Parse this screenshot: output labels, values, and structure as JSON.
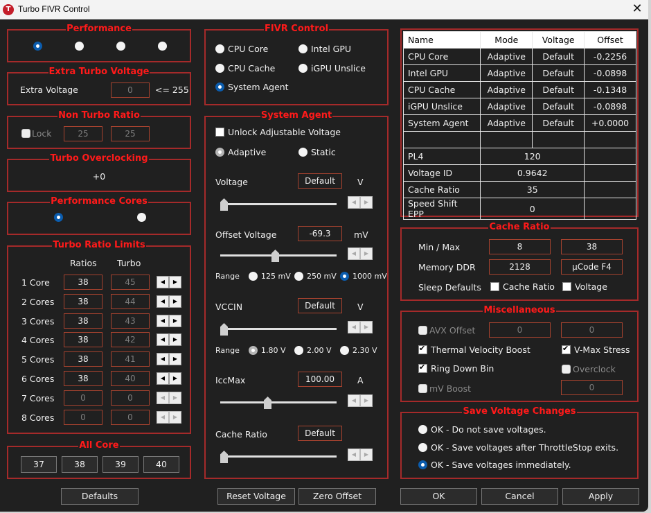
{
  "window": {
    "title": "Turbo FIVR Control",
    "icon": "throttlestop-icon",
    "close_glyph": "✕"
  },
  "performance": {
    "legend": "Performance",
    "options": [
      {
        "selected": true
      },
      {
        "selected": false
      },
      {
        "selected": false
      },
      {
        "selected": false
      }
    ]
  },
  "extra_turbo": {
    "legend": "Extra Turbo Voltage",
    "label": "Extra Voltage",
    "value": "0",
    "limit": "<= 255"
  },
  "non_turbo": {
    "legend": "Non Turbo Ratio",
    "lock_label": "Lock",
    "lock_checked": false,
    "value1": "25",
    "value2": "25"
  },
  "turbo_oc": {
    "legend": "Turbo Overclocking",
    "value": "+0"
  },
  "perf_cores": {
    "legend": "Performance Cores",
    "options": [
      {
        "selected": true
      },
      {
        "selected": false
      }
    ]
  },
  "turbo_limits": {
    "legend": "Turbo Ratio Limits",
    "col_ratios": "Ratios",
    "col_turbo": "Turbo",
    "rows": [
      {
        "label": "1 Core",
        "ratio": "38",
        "turbo": "45",
        "enabled": true
      },
      {
        "label": "2 Cores",
        "ratio": "38",
        "turbo": "44",
        "enabled": true
      },
      {
        "label": "3 Cores",
        "ratio": "38",
        "turbo": "43",
        "enabled": true
      },
      {
        "label": "4 Cores",
        "ratio": "38",
        "turbo": "42",
        "enabled": true
      },
      {
        "label": "5 Cores",
        "ratio": "38",
        "turbo": "41",
        "enabled": true
      },
      {
        "label": "6 Cores",
        "ratio": "38",
        "turbo": "40",
        "enabled": true
      },
      {
        "label": "7 Cores",
        "ratio": "0",
        "turbo": "0",
        "enabled": false
      },
      {
        "label": "8 Cores",
        "ratio": "0",
        "turbo": "0",
        "enabled": false
      }
    ]
  },
  "all_core": {
    "legend": "All Core",
    "buttons": [
      "37",
      "38",
      "39",
      "40"
    ]
  },
  "defaults_button": "Defaults",
  "fivr_control": {
    "legend": "FIVR Control",
    "options": [
      {
        "label": "CPU Core",
        "selected": false
      },
      {
        "label": "Intel GPU",
        "selected": false
      },
      {
        "label": "CPU Cache",
        "selected": false
      },
      {
        "label": "iGPU Unslice",
        "selected": false
      },
      {
        "label": "System Agent",
        "selected": true
      }
    ]
  },
  "system_agent": {
    "legend": "System Agent",
    "unlock_label": "Unlock Adjustable Voltage",
    "unlock_checked": false,
    "mode_adaptive": "Adaptive",
    "mode_static": "Static",
    "voltage": {
      "label": "Voltage",
      "value": "Default",
      "unit": "V",
      "slider_fraction": 0.0
    },
    "offset_voltage": {
      "label": "Offset Voltage",
      "value": "-69.3",
      "unit": "mV",
      "slider_fraction": 0.47
    },
    "offset_range": {
      "label": "Range",
      "options": [
        {
          "label": "125 mV",
          "selected": false
        },
        {
          "label": "250 mV",
          "selected": false
        },
        {
          "label": "1000 mV",
          "selected": true
        }
      ]
    },
    "vccin": {
      "label": "VCCIN",
      "value": "Default",
      "unit": "V",
      "slider_fraction": 0.0
    },
    "vccin_range": {
      "label": "Range",
      "options": [
        {
          "label": "1.80 V",
          "selected": true
        },
        {
          "label": "2.00 V",
          "selected": false
        },
        {
          "label": "2.30 V",
          "selected": false
        }
      ]
    },
    "iccmax": {
      "label": "IccMax",
      "value": "100.00",
      "unit": "A",
      "slider_fraction": 0.4
    },
    "cache_ratio": {
      "label": "Cache Ratio",
      "value": "Default",
      "slider_fraction": 0.0
    }
  },
  "reset_voltage_button": "Reset Voltage",
  "zero_offset_button": "Zero Offset",
  "info_table": {
    "headers": [
      "Name",
      "Mode",
      "Voltage",
      "Offset"
    ],
    "rows": [
      [
        "CPU Core",
        "Adaptive",
        "Default",
        "-0.2256"
      ],
      [
        "Intel GPU",
        "Adaptive",
        "Default",
        "-0.0898"
      ],
      [
        "CPU Cache",
        "Adaptive",
        "Default",
        "-0.1348"
      ],
      [
        "iGPU Unslice",
        "Adaptive",
        "Default",
        "-0.0898"
      ],
      [
        "System Agent",
        "Adaptive",
        "Default",
        "+0.0000"
      ]
    ],
    "extra_rows": [
      [
        "PL4",
        "120"
      ],
      [
        "Voltage ID",
        "0.9642"
      ],
      [
        "Cache Ratio",
        "35"
      ],
      [
        "Speed Shift EPP",
        "0"
      ]
    ]
  },
  "cache_ratio_group": {
    "legend": "Cache Ratio",
    "min_max_label": "Min / Max",
    "min": "8",
    "max": "38",
    "memory_label": "Memory DDR",
    "memory": "2128",
    "ucode": "µCode F4",
    "sleep_label": "Sleep Defaults",
    "sleep_cache_label": "Cache Ratio",
    "sleep_voltage_label": "Voltage"
  },
  "misc": {
    "legend": "Miscellaneous",
    "avx_label": "AVX Offset",
    "avx_value1": "0",
    "avx_value2": "0",
    "tvb_label": "Thermal Velocity Boost",
    "tvb_checked": true,
    "vmax_label": "V-Max Stress",
    "vmax_checked": true,
    "rdb_label": "Ring Down Bin",
    "rdb_checked": true,
    "overclock_label": "Overclock",
    "mvboost_label": "mV Boost",
    "mvboost_value": "0"
  },
  "save_voltage": {
    "legend": "Save Voltage Changes",
    "options": [
      {
        "label": "OK - Do not save voltages.",
        "selected": false
      },
      {
        "label": "OK - Save voltages after ThrottleStop exits.",
        "selected": false
      },
      {
        "label": "OK - Save voltages immediately.",
        "selected": true
      }
    ]
  },
  "footer": {
    "ok": "OK",
    "cancel": "Cancel",
    "apply": "Apply"
  }
}
